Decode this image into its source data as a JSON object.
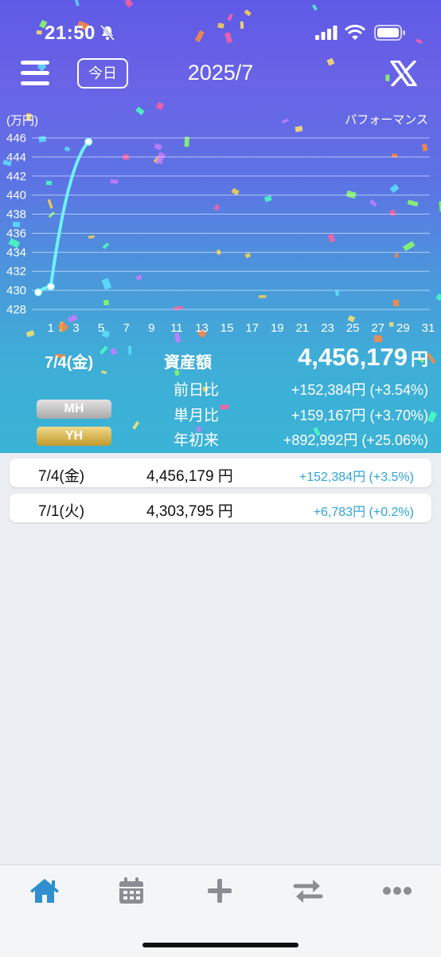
{
  "status_bar": {
    "time": "21:50"
  },
  "nav": {
    "today_label": "今日",
    "title": "2025/7"
  },
  "chart_header": {
    "unit_label": "(万円)",
    "mode_label": "パフォーマンス"
  },
  "chart_data": {
    "type": "line",
    "x": [
      0,
      1,
      4
    ],
    "values": [
      429.8,
      430.4,
      445.6
    ],
    "ylim": [
      428,
      446
    ],
    "xlim": [
      0,
      31
    ],
    "yticks": [
      446,
      444,
      442,
      440,
      438,
      436,
      434,
      432,
      430,
      428
    ],
    "xticks": [
      1,
      3,
      5,
      7,
      9,
      11,
      13,
      15,
      17,
      19,
      21,
      23,
      25,
      27,
      29,
      31
    ],
    "ylabel": "(万円)",
    "grid": true,
    "line_color": "#6ff3ff"
  },
  "summary": {
    "date": "7/4(金)",
    "total_label": "資産額",
    "total_value": "4,456,179",
    "total_unit": "円",
    "rows": [
      {
        "label": "前日比",
        "value": "+152,384円 (+3.54%)"
      },
      {
        "label": "単月比",
        "value": "+159,167円 (+3.70%)"
      },
      {
        "label": "年初来",
        "value": "+892,992円 (+25.06%)"
      }
    ],
    "badges": {
      "mh": "MH",
      "yh": "YH"
    }
  },
  "history": [
    {
      "date": "7/4(金)",
      "value": "4,456,179 円",
      "change": "+152,384円 (+3.5%)"
    },
    {
      "date": "7/1(火)",
      "value": "4,303,795 円",
      "change": "+6,783円 (+0.2%)"
    }
  ],
  "tabs": [
    {
      "icon": "home-icon",
      "active": true
    },
    {
      "icon": "calendar-icon",
      "active": false
    },
    {
      "icon": "plus-icon",
      "active": false
    },
    {
      "icon": "transfer-icon",
      "active": false
    },
    {
      "icon": "more-icon",
      "active": false
    }
  ],
  "colors": {
    "accent": "#2f8fcf",
    "tab_inactive": "#8a8d92",
    "positive": "#2ea6d6"
  }
}
